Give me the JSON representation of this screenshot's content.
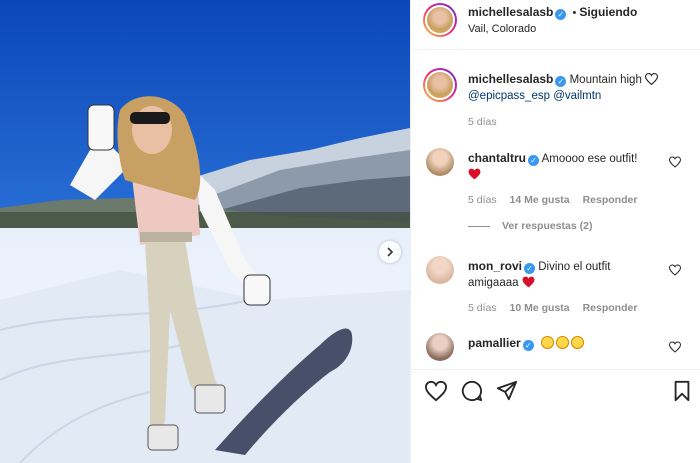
{
  "post": {
    "author": "michellesalasb",
    "follow_separator": "•",
    "follow_label": "Siguiendo",
    "location": "Vail, Colorado",
    "caption_text": "Mountain high",
    "caption_mentions": "@epicpass_esp @vailmtn",
    "caption_time": "5 días"
  },
  "comments": [
    {
      "user": "chantaltru",
      "text": "Amoooo ese outfit!",
      "time": "5 días",
      "likes": "14 Me gusta",
      "reply": "Responder",
      "view_replies": "Ver respuestas (2)"
    },
    {
      "user": "mon_rovi",
      "text": "Divino el outfit",
      "text2": "amigaaaa",
      "time": "5 días",
      "likes": "10 Me gusta",
      "reply": "Responder"
    },
    {
      "user": "pamallier",
      "text": ""
    }
  ],
  "colors": {
    "verified": "#3897f0",
    "link": "#00376b",
    "muted": "#8e8e8e",
    "sky": "#1f5fc9"
  },
  "icons": [
    "heart-icon",
    "comment-icon",
    "share-icon",
    "bookmark-icon",
    "chevron-right-icon",
    "verified-badge-icon"
  ]
}
